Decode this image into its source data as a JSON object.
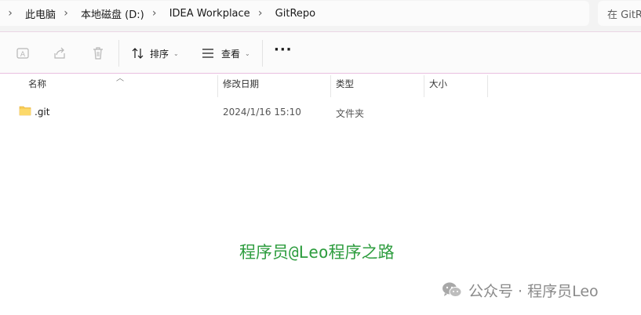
{
  "address_bar": {
    "breadcrumbs": [
      "此电脑",
      "本地磁盘 (D:)",
      "IDEA Workplace",
      "GitRepo"
    ],
    "search_placeholder": "在 GitR"
  },
  "command_bar": {
    "sort_label": "排序",
    "view_label": "查看",
    "more_label": "···"
  },
  "columns": {
    "name": "名称",
    "date_modified": "修改日期",
    "type": "类型",
    "size": "大小"
  },
  "files": [
    {
      "name": ".git",
      "date_modified": "2024/1/16 15:10",
      "type": "文件夹",
      "size": ""
    }
  ],
  "watermark": {
    "center_text": "程序员@Leo程序之路",
    "wechat_text": "公众号 · 程序员Leo"
  },
  "colors": {
    "accent_green": "#2e9d3f",
    "folder_yellow": "#f8cd57"
  }
}
